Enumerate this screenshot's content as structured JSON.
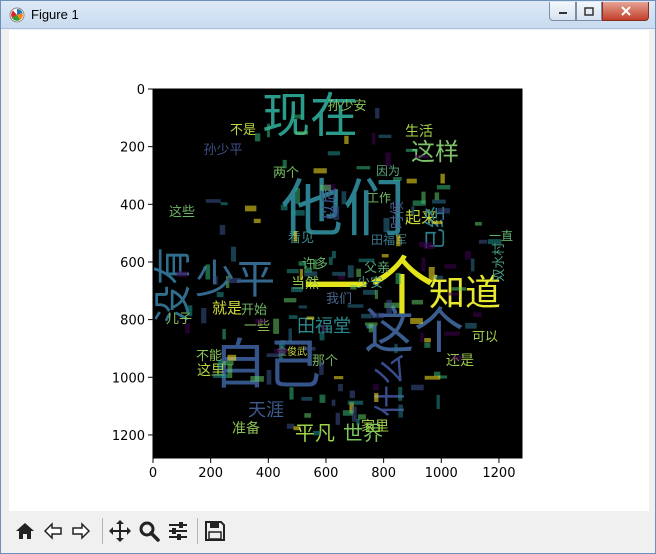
{
  "window": {
    "title": "Figure 1"
  },
  "chart_data": {
    "type": "image",
    "x_ticks": [
      "0",
      "200",
      "400",
      "600",
      "800",
      "1000",
      "1200"
    ],
    "y_ticks": [
      "0",
      "200",
      "400",
      "600",
      "800",
      "1000",
      "1200"
    ],
    "xlim": [
      0,
      1280
    ],
    "ylim": [
      1280,
      0
    ]
  },
  "wordcloud": {
    "words": [
      {
        "text": "他们",
        "color": "#2c7f8e"
      },
      {
        "text": "现在",
        "color": "#2a9a8a"
      },
      {
        "text": "一个",
        "color": "#e4e41a"
      },
      {
        "text": "自己",
        "color": "#35548a"
      },
      {
        "text": "这个",
        "color": "#3b5c8e"
      },
      {
        "text": "没有",
        "color": "#2f6f8d"
      },
      {
        "text": "少平",
        "color": "#34688e"
      },
      {
        "text": "知道",
        "color": "#e8e830"
      },
      {
        "text": "这样",
        "color": "#7ec36a"
      },
      {
        "text": "什么",
        "color": "#3a4b8b"
      },
      {
        "text": "平凡",
        "color": "#9fd34a"
      },
      {
        "text": "世界",
        "color": "#7cc75a"
      },
      {
        "text": "天涯",
        "color": "#3d5a8d"
      },
      {
        "text": "田福堂",
        "color": "#2c8a8d"
      },
      {
        "text": "孙少安",
        "color": "#8cc85a"
      },
      {
        "text": "就是",
        "color": "#d4de3a"
      },
      {
        "text": "起来",
        "color": "#c8d838"
      },
      {
        "text": "生活",
        "color": "#a6d646"
      },
      {
        "text": "已经",
        "color": "#2d7e8e"
      },
      {
        "text": "这里",
        "color": "#b8d840"
      },
      {
        "text": "还是",
        "color": "#9cc84e"
      },
      {
        "text": "那个",
        "color": "#7ab85c"
      },
      {
        "text": "家里",
        "color": "#a0cc4a"
      },
      {
        "text": "准备",
        "color": "#8cc054"
      },
      {
        "text": "当然",
        "color": "#93c84e"
      },
      {
        "text": "一些",
        "color": "#8cbd58"
      },
      {
        "text": "看见",
        "color": "#3a8f8a"
      },
      {
        "text": "以后",
        "color": "#3a558c"
      },
      {
        "text": "不是",
        "color": "#b9d843"
      },
      {
        "text": "因为",
        "color": "#59a87a"
      },
      {
        "text": "工作",
        "color": "#6fbf64"
      },
      {
        "text": "可以",
        "color": "#a8d24a"
      },
      {
        "text": "一直",
        "color": "#5fb070"
      },
      {
        "text": "双水村",
        "color": "#4a9a84"
      },
      {
        "text": "我们",
        "color": "#48668d"
      },
      {
        "text": "开始",
        "color": "#6fb664"
      },
      {
        "text": "儿子",
        "color": "#8ac05a"
      },
      {
        "text": "不能",
        "color": "#89c45a"
      },
      {
        "text": "许多",
        "color": "#68b06c"
      },
      {
        "text": "父亲",
        "color": "#5aa878"
      },
      {
        "text": "少安",
        "color": "#4c9a86"
      },
      {
        "text": "两个",
        "color": "#76be60"
      },
      {
        "text": "这些",
        "color": "#6cb466"
      },
      {
        "text": "孙少平",
        "color": "#3f4f8a"
      },
      {
        "text": "时候",
        "color": "#4a5e8c"
      },
      {
        "text": "田福军",
        "color": "#3d7a8d"
      },
      {
        "text": "金俊武",
        "color": "#c8d83a"
      }
    ]
  },
  "toolbar": {
    "buttons": [
      "home",
      "back",
      "forward",
      "pan",
      "zoom",
      "configure-subplots",
      "save"
    ]
  }
}
